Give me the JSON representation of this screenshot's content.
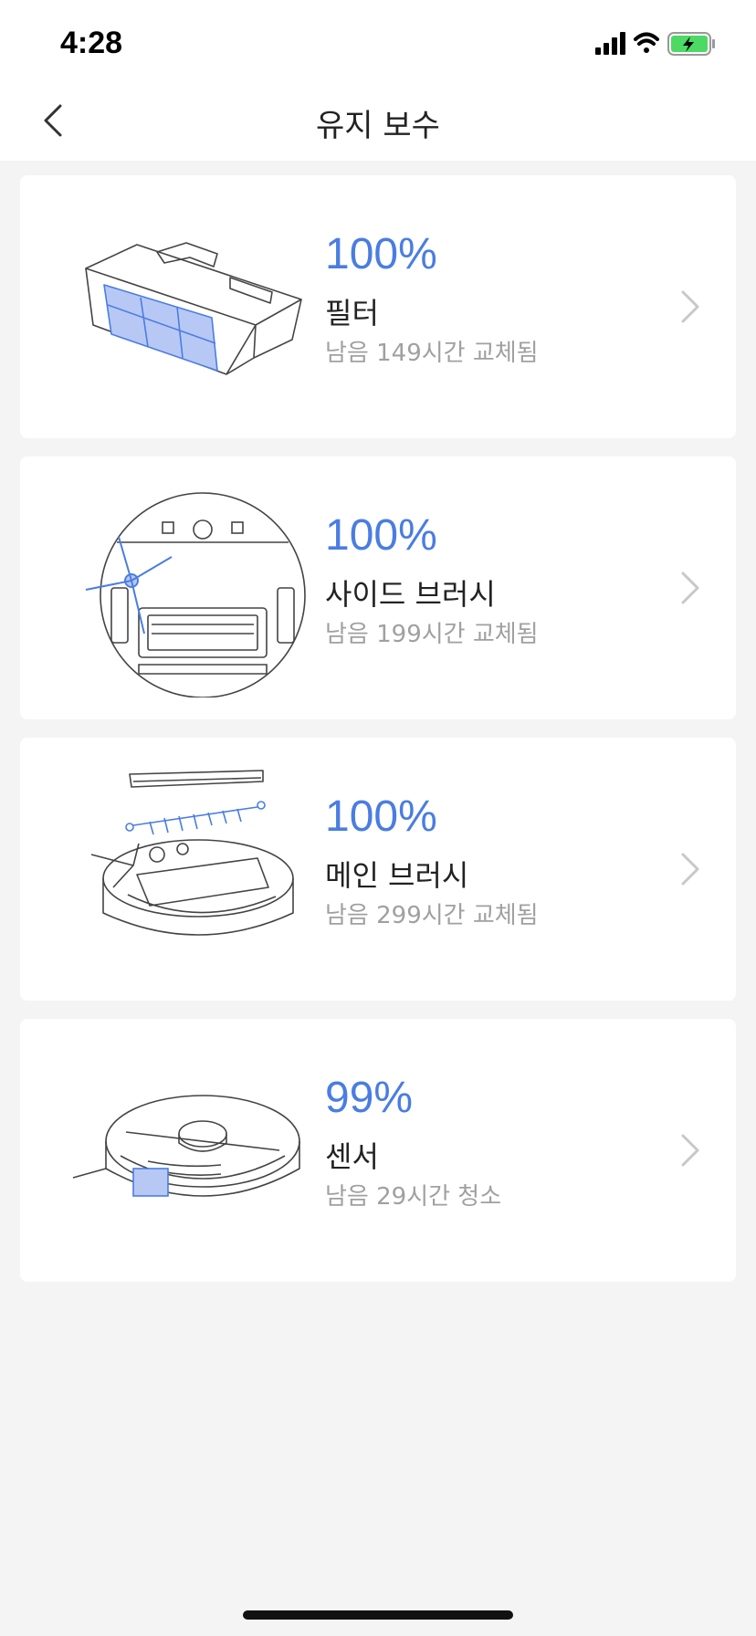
{
  "status_bar": {
    "time": "4:28",
    "icons": [
      "signal-icon",
      "wifi-icon",
      "battery-charging-icon"
    ]
  },
  "nav": {
    "title": "유지 보수",
    "back_icon": "chevron-left-icon"
  },
  "colors": {
    "accent": "#4a7de2",
    "background": "#f4f4f5",
    "card": "#ffffff",
    "secondary_text": "#a0a0a0",
    "illustration_highlight": "#b8c8f5"
  },
  "items": [
    {
      "percent": "100%",
      "level": 100,
      "name": "필터",
      "remaining": "남음 149시간 교체됨",
      "icon": "filter-illustration"
    },
    {
      "percent": "100%",
      "level": 100,
      "name": "사이드 브러시",
      "remaining": "남음 199시간 교체됨",
      "icon": "side-brush-illustration"
    },
    {
      "percent": "100%",
      "level": 100,
      "name": "메인 브러시",
      "remaining": "남음 299시간 교체됨",
      "icon": "main-brush-illustration"
    },
    {
      "percent": "99%",
      "level": 99,
      "name": "센서",
      "remaining": "남음 29시간 청소",
      "icon": "sensor-illustration"
    }
  ]
}
